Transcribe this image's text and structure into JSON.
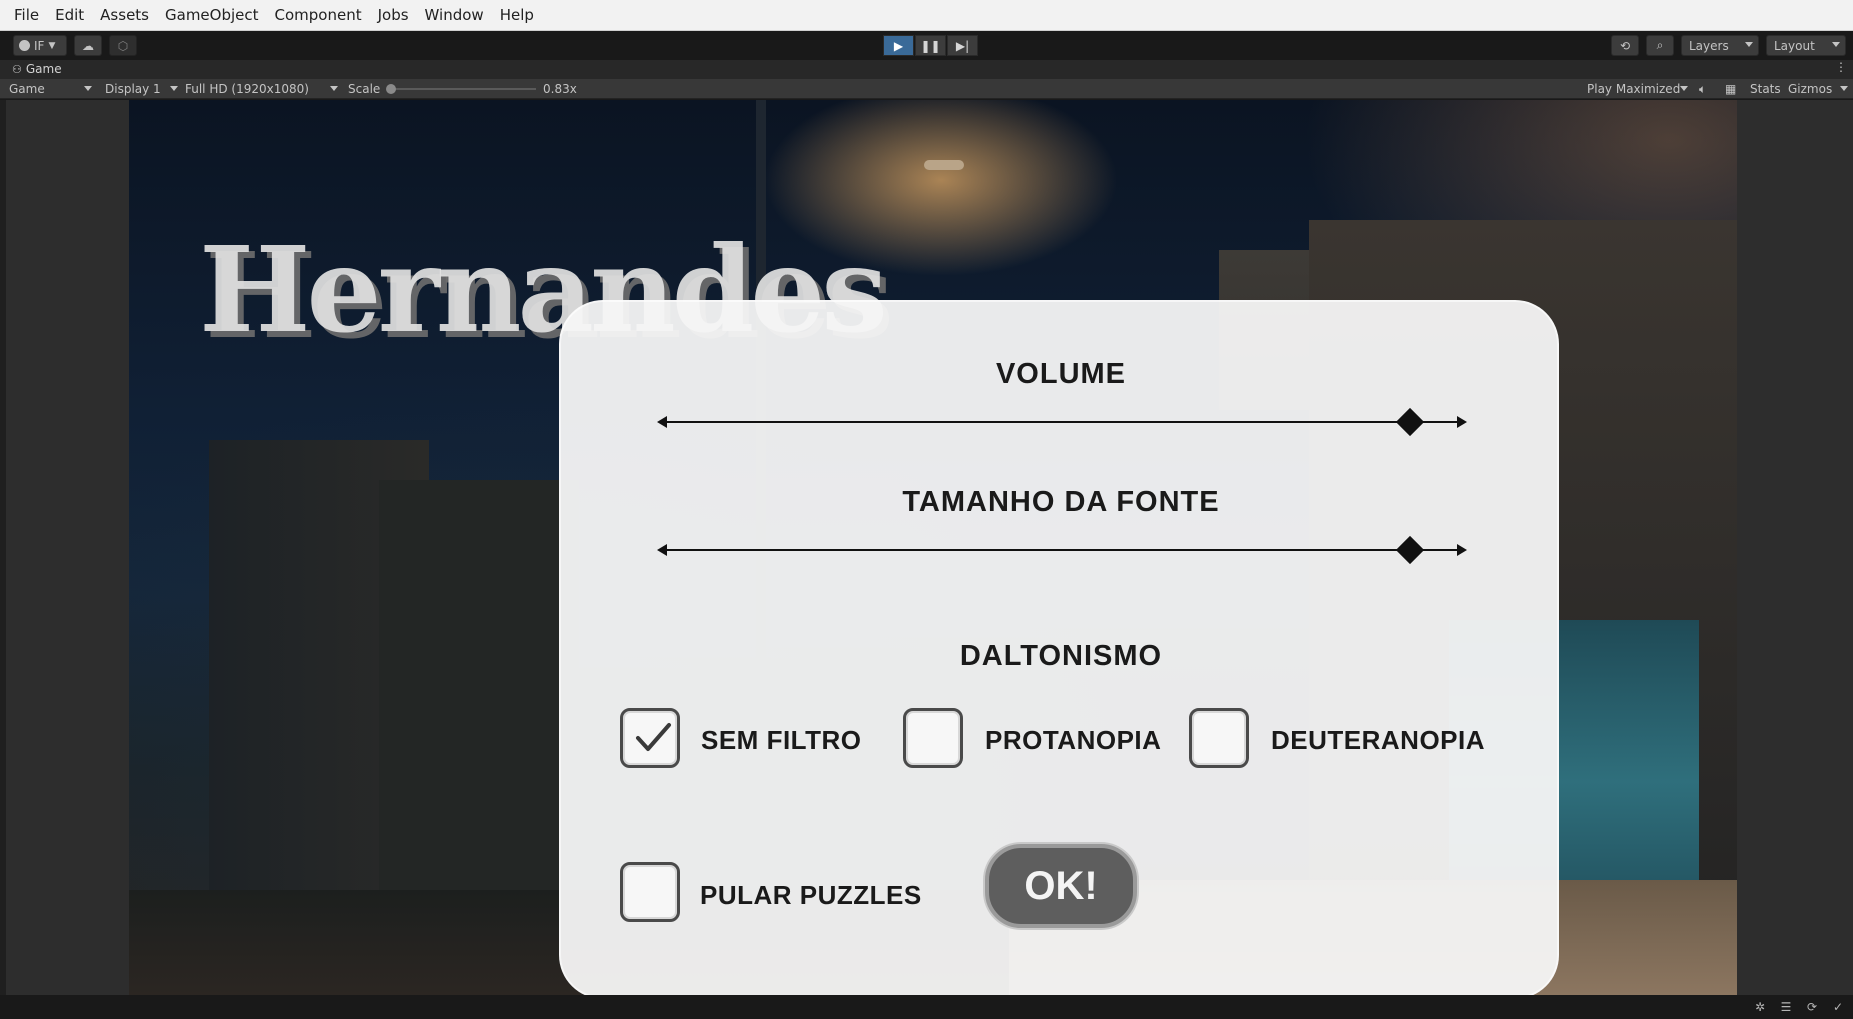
{
  "menubar": {
    "items": [
      "File",
      "Edit",
      "Assets",
      "GameObject",
      "Component",
      "Jobs",
      "Window",
      "Help"
    ]
  },
  "toolbar": {
    "account_label": "IF",
    "layers_label": "Layers",
    "layout_label": "Layout",
    "icons": {
      "account": "account-icon",
      "cloud": "cloud-icon",
      "collab": "collab-icon",
      "play": "play-icon",
      "pause": "pause-icon",
      "step": "step-icon",
      "history": "history-icon",
      "search": "search-icon"
    },
    "play_active_color": "#3a6a98"
  },
  "tab": {
    "label": "Game"
  },
  "game_toolbar": {
    "view_label": "Game",
    "display_label": "Display 1",
    "resolution_label": "Full HD (1920x1080)",
    "scale_label": "Scale",
    "scale_value": "0.83x",
    "play_mode_label": "Play Maximized",
    "stats_label": "Stats",
    "gizmos_label": "Gizmos"
  },
  "game": {
    "logo_text": "Hernandes",
    "settings": {
      "volume_title": "VOLUME",
      "volume_value": 0.94,
      "font_size_title": "TAMANHO DA FONTE",
      "font_size_value": 0.94,
      "colorblind_title": "DALTONISMO",
      "filters": [
        {
          "label": "SEM FILTRO",
          "checked": true
        },
        {
          "label": "PROTANOPIA",
          "checked": false
        },
        {
          "label": "DEUTERANOPIA",
          "checked": false
        }
      ],
      "skip_puzzles_label": "PULAR PUZZLES",
      "skip_puzzles_checked": false,
      "ok_label": "OK!"
    }
  }
}
